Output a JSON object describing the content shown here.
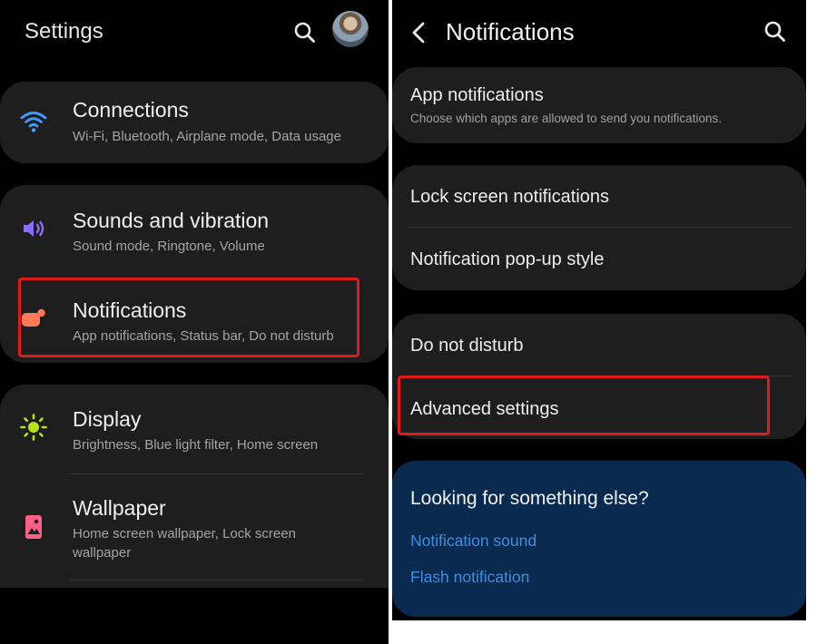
{
  "left": {
    "title": "Settings",
    "search_icon": "search-icon",
    "avatar": "avatar",
    "items": [
      {
        "icon": "wifi-icon",
        "title": "Connections",
        "subtitle": "Wi-Fi, Bluetooth, Airplane mode, Data usage"
      },
      {
        "icon": "volume-icon",
        "title": "Sounds and vibration",
        "subtitle": "Sound mode, Ringtone, Volume"
      },
      {
        "icon": "notification-icon",
        "title": "Notifications",
        "subtitle": "App notifications, Status bar, Do not disturb"
      },
      {
        "icon": "brightness-icon",
        "title": "Display",
        "subtitle": "Brightness, Blue light filter, Home screen"
      },
      {
        "icon": "wallpaper-icon",
        "title": "Wallpaper",
        "subtitle_line1": "Home screen wallpaper, Lock screen",
        "subtitle_line2": "wallpaper"
      }
    ]
  },
  "right": {
    "title": "Notifications",
    "back_icon": "chevron-left-icon",
    "search_icon": "search-icon",
    "app_notifications": {
      "title": "App notifications",
      "subtitle": "Choose which apps are allowed to send you notifications."
    },
    "lock_screen": "Lock screen notifications",
    "popup_style": "Notification pop-up style",
    "dnd": "Do not disturb",
    "advanced": "Advanced settings",
    "looking": {
      "title": "Looking for something else?",
      "links": [
        "Notification sound",
        "Flash notification"
      ]
    }
  },
  "colors": {
    "background": "#000000",
    "card": "#1e1e1e",
    "highlight": "#e01b1b",
    "link": "#3d8ee6",
    "suggestion_card": "#0a2a4f",
    "wifi_icon": "#3f9bff",
    "volume_icon": "#8a6cff",
    "notification_icon": "#ff7a59",
    "brightness_icon": "#b6e21b",
    "wallpaper_icon": "#ff5f86"
  }
}
